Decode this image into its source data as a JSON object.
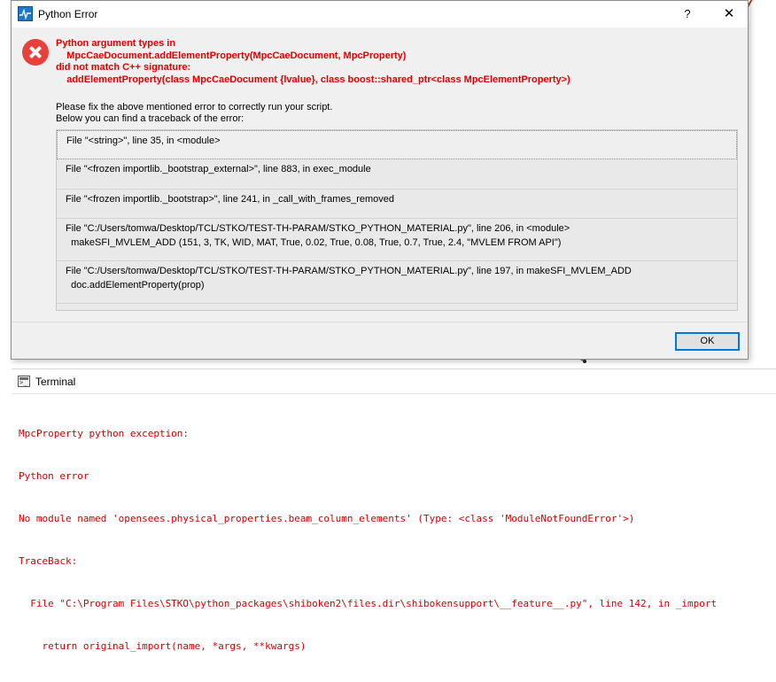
{
  "dialog": {
    "title": "Python Error",
    "help_label": "?",
    "close_label": "✕",
    "error_lines": [
      "Python argument types in",
      "    MpcCaeDocument.addElementProperty(MpcCaeDocument, MpcProperty)",
      "did not match C++ signature:",
      "    addElementProperty(class MpcCaeDocument {lvalue}, class boost::shared_ptr<class MpcElementProperty>)"
    ],
    "instructions": [
      "Please fix the above mentioned error to correctly run your script.",
      "Below you can find a traceback of the error:"
    ],
    "traceback": [
      {
        "text": "File \"<string>\", line 35, in <module>"
      },
      {
        "text": "File \"<frozen importlib._bootstrap_external>\", line 883, in exec_module"
      },
      {
        "text": "File \"<frozen importlib._bootstrap>\", line 241, in _call_with_frames_removed"
      },
      {
        "text": "File \"C:/Users/tomwa/Desktop/TCL/STKO/TEST-TH-PARAM/STKO_PYTHON_MATERIAL.py\", line 206, in <module>\n  makeSFI_MVLEM_ADD (151, 3, TK, WID, MAT, True, 0.02, True, 0.08, True, 0.7, True, 2.4, \"MVLEM FROM API\")"
      },
      {
        "text": "File \"C:/Users/tomwa/Desktop/TCL/STKO/TEST-TH-PARAM/STKO_PYTHON_MATERIAL.py\", line 197, in makeSFI_MVLEM_ADD\n  doc.addElementProperty(prop)"
      }
    ],
    "ok_label": "OK"
  },
  "terminal": {
    "title": "Terminal",
    "lines": [
      "MpcProperty python exception:",
      "Python error",
      "No module named 'opensees.physical_properties.beam_column_elements' (Type: <class 'ModuleNotFoundError'>)",
      "TraceBack:",
      "  File \"C:\\Program Files\\STKO\\python_packages\\shiboken2\\files.dir\\shibokensupport\\__feature__.py\", line 142, in _import",
      "    return original_import(name, *args, **kwargs)"
    ]
  },
  "colors": {
    "error_text": "#e00000",
    "terminal_text": "#d00000",
    "accent": "#0078d7"
  }
}
